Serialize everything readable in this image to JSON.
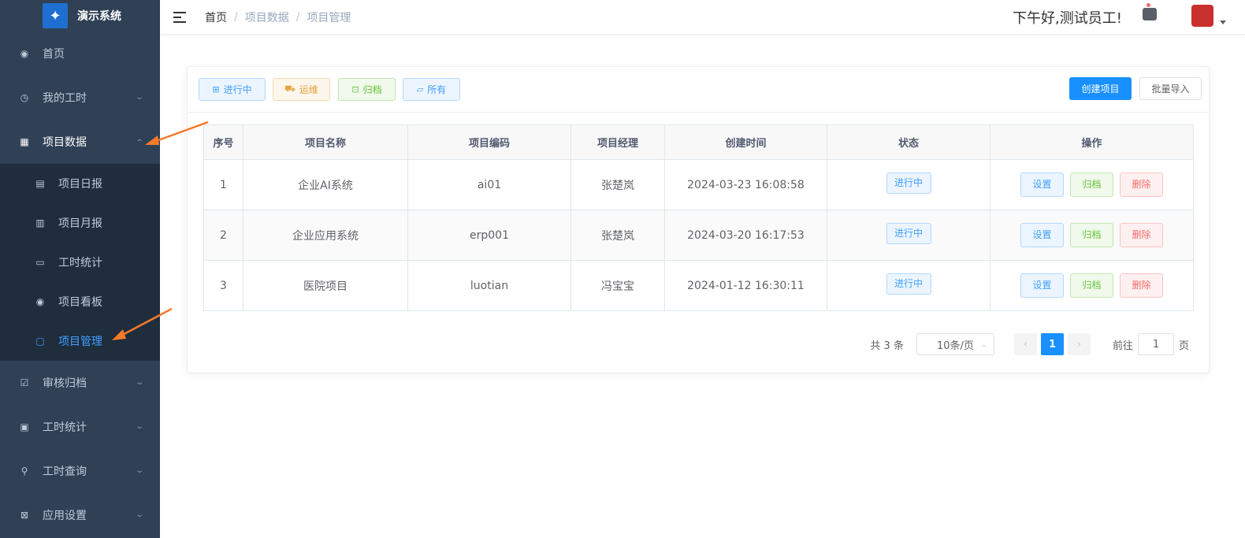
{
  "app": {
    "name": "演示系统",
    "logo_icon": "app-logo"
  },
  "sidebar": {
    "items": [
      {
        "label": "首页",
        "icon": "dashboard-icon"
      },
      {
        "label": "我的工时",
        "icon": "clock-icon"
      },
      {
        "label": "项目数据",
        "icon": "grid-icon"
      },
      {
        "label": "审核归档",
        "icon": "check-square-icon"
      },
      {
        "label": "工时统计",
        "icon": "chart-icon"
      },
      {
        "label": "工时查询",
        "icon": "search-icon"
      },
      {
        "label": "应用设置",
        "icon": "settings-icon"
      }
    ],
    "subitems": [
      {
        "label": "项目日报",
        "icon": "document-icon"
      },
      {
        "label": "项目月报",
        "icon": "document-icon"
      },
      {
        "label": "工时统计",
        "icon": "table-icon"
      },
      {
        "label": "项目看板",
        "icon": "dashboard-icon"
      },
      {
        "label": "项目管理",
        "icon": "folder-icon"
      }
    ]
  },
  "header": {
    "breadcrumb": [
      "首页",
      "项目数据",
      "项目管理"
    ],
    "separator": "/",
    "greeting": "下午好,测试员工!"
  },
  "toolbar": {
    "filters": [
      "进行中",
      "运维",
      "归档",
      "所有"
    ],
    "create_label": "创建项目",
    "import_label": "批量导入"
  },
  "table": {
    "columns": [
      "序号",
      "项目名称",
      "项目编码",
      "项目经理",
      "创建时间",
      "状态",
      "操作"
    ],
    "rows": [
      {
        "index": "1",
        "name": "企业AI系统",
        "code": "ai01",
        "manager": "张楚岚",
        "created": "2024-03-23 16:08:58",
        "status": "进行中"
      },
      {
        "index": "2",
        "name": "企业应用系统",
        "code": "erp001",
        "manager": "张楚岚",
        "created": "2024-03-20 16:17:53",
        "status": "进行中"
      },
      {
        "index": "3",
        "name": "医院项目",
        "code": "luotian",
        "manager": "冯宝宝",
        "created": "2024-01-12 16:30:11",
        "status": "进行中"
      }
    ],
    "actions": {
      "set": "设置",
      "archive": "归档",
      "delete": "删除"
    }
  },
  "pagination": {
    "total_label": "共 3 条",
    "page_size": "10条/页",
    "current_page": "1",
    "goto_label": "前往",
    "goto_value": "1",
    "page_suffix": "页"
  },
  "colors": {
    "sidebar_bg": "#304156",
    "primary": "#1890ff",
    "active_menu": "#409eff"
  }
}
